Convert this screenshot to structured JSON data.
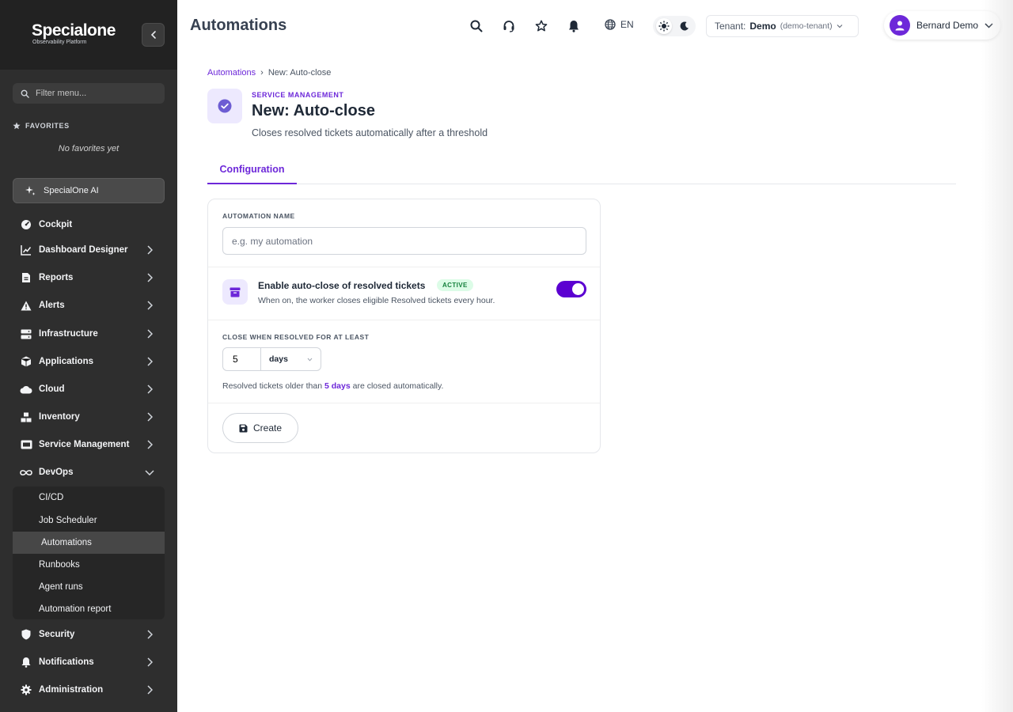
{
  "sidebar": {
    "logo_main": "Specialone",
    "logo_sub": "Observability Platform",
    "filter_placeholder": "Filter menu...",
    "favorites_title": "FAVORITES",
    "favorites_empty": "No favorites yet",
    "ai_label": "SpecialOne AI",
    "items": [
      {
        "label": "Cockpit",
        "icon": "gauge-icon"
      },
      {
        "label": "Dashboard Designer",
        "icon": "chart-line-icon"
      },
      {
        "label": "Reports",
        "icon": "file-icon"
      },
      {
        "label": "Alerts",
        "icon": "warning-icon"
      },
      {
        "label": "Infrastructure",
        "icon": "server-icon"
      },
      {
        "label": "Applications",
        "icon": "box-icon"
      },
      {
        "label": "Cloud",
        "icon": "cloud-icon"
      },
      {
        "label": "Inventory",
        "icon": "boxes-icon"
      },
      {
        "label": "Service Management",
        "icon": "ticket-icon"
      },
      {
        "label": "DevOps",
        "icon": "infinity-icon"
      },
      {
        "label": "Security",
        "icon": "shield-icon"
      },
      {
        "label": "Notifications",
        "icon": "bell-icon"
      },
      {
        "label": "Administration",
        "icon": "gear-icon"
      }
    ],
    "devops_sub": [
      "CI/CD",
      "Job Scheduler",
      "Automations",
      "Runbooks",
      "Agent runs",
      "Automation report"
    ],
    "active_sub": "Automations"
  },
  "header": {
    "title": "Automations",
    "lang": "EN",
    "tenant_label": "Tenant:",
    "tenant_name": "Demo",
    "tenant_id": "(demo-tenant)",
    "user_name": "Bernard Demo"
  },
  "breadcrumb": {
    "parent": "Automations",
    "separator": "›",
    "current": "New: Auto-close"
  },
  "page": {
    "eyebrow": "SERVICE MANAGEMENT",
    "title": "New: Auto-close",
    "description": "Closes resolved tickets automatically after a threshold",
    "tab": "Configuration"
  },
  "form": {
    "name_label": "AUTOMATION NAME",
    "name_placeholder": "e.g. my automation",
    "name_value": "",
    "toggle_title": "Enable auto-close of resolved tickets",
    "toggle_badge": "ACTIVE",
    "toggle_desc": "When on, the worker closes eligible Resolved tickets every hour.",
    "toggle_on": true,
    "threshold_label": "CLOSE WHEN RESOLVED FOR AT LEAST",
    "threshold_value": "5",
    "threshold_unit": "days",
    "hint_pre": "Resolved tickets older than",
    "hint_value": "5 days",
    "hint_post": "are closed automatically.",
    "create_label": "Create"
  },
  "colors": {
    "accent": "#6d28d9",
    "toggle": "#5b00d1",
    "sidebar_bg": "#2e2e2e",
    "badge_bg": "#dcfce7",
    "badge_text": "#15803d"
  }
}
